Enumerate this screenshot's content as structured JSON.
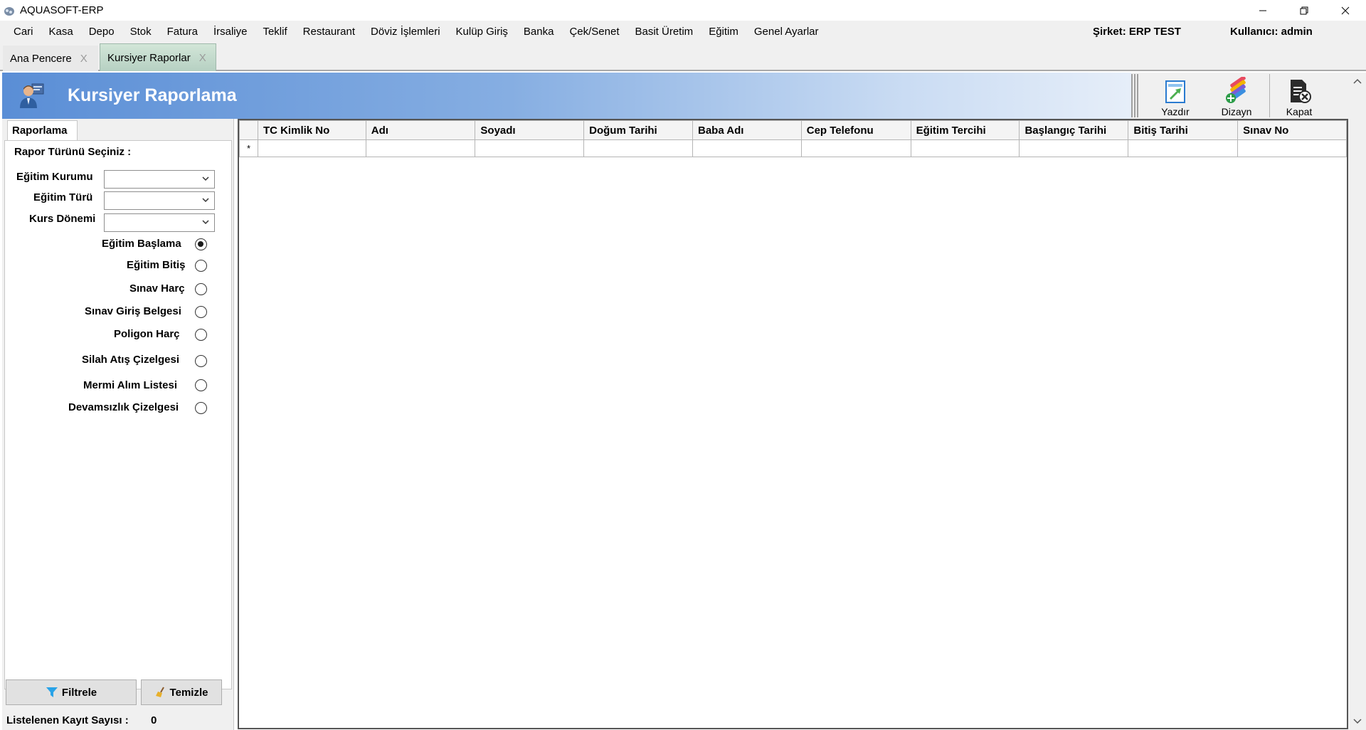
{
  "window": {
    "title": "AQUASOFT-ERP"
  },
  "menu": {
    "items": [
      "Cari",
      "Kasa",
      "Depo",
      "Stok",
      "Fatura",
      "İrsaliye",
      "Teklif",
      "Restaurant",
      "Döviz İşlemleri",
      "Kulüp Giriş",
      "Banka",
      "Çek/Senet",
      "Basit Üretim",
      "Eğitim",
      "Genel Ayarlar"
    ],
    "company": "Şirket: ERP TEST",
    "user": "Kullanıcı: admin"
  },
  "tabs": [
    {
      "label": "Ana Pencere",
      "close": "X",
      "active": false
    },
    {
      "label": "Kursiyer Raporlar",
      "close": "X",
      "active": true
    }
  ],
  "header": {
    "title": "Kursiyer Raporlama"
  },
  "toolbar": {
    "print_label": "Yazdır",
    "design_label": "Dizayn",
    "close_label": "Kapat"
  },
  "left_panel": {
    "tab_label": "Raporlama",
    "report_type_label": "Rapor Türünü Seçiniz :",
    "fields": {
      "institution_label": "Eğitim Kurumu",
      "institution_value": "",
      "type_label": "Eğitim Türü",
      "type_value": "",
      "period_label": "Kurs Dönemi",
      "period_value": ""
    },
    "report_options": [
      {
        "label": "Eğitim Başlama",
        "checked": true
      },
      {
        "label": "Eğitim Bitiş",
        "checked": false
      },
      {
        "label": "Sınav Harç",
        "checked": false
      },
      {
        "label": "Sınav Giriş Belgesi",
        "checked": false
      },
      {
        "label": "Poligon Harç",
        "checked": false
      },
      {
        "label": "Silah Atış Çizelgesi",
        "checked": false
      },
      {
        "label": "Mermi Alım Listesi",
        "checked": false
      },
      {
        "label": "Devamsızlık Çizelgesi",
        "checked": false
      }
    ],
    "filter_button": "Filtrele",
    "clear_button": "Temizle",
    "record_count_label": "Listelenen Kayıt Sayısı :",
    "record_count": "0"
  },
  "grid": {
    "new_row_marker": "*",
    "columns": [
      "TC Kimlik No",
      "Adı",
      "Soyadı",
      "Doğum Tarihi",
      "Baba Adı",
      "Cep Telefonu",
      "Eğitim Tercihi",
      "Başlangıç Tarihi",
      "Bitiş Tarihi",
      "Sınav No"
    ],
    "rows": []
  },
  "colors": {
    "header_gradient_start": "#5a8ed6",
    "header_gradient_end": "#e6eef9",
    "active_tab": "#b6d0c2",
    "menu_bg": "#f0f0f0"
  },
  "icons": {
    "app": "aquasoft-logo-icon",
    "header": "user-report-icon",
    "print": "print-icon",
    "design": "design-palette-icon",
    "close": "close-document-icon",
    "filter": "filter-funnel-icon",
    "clear": "broom-icon"
  }
}
